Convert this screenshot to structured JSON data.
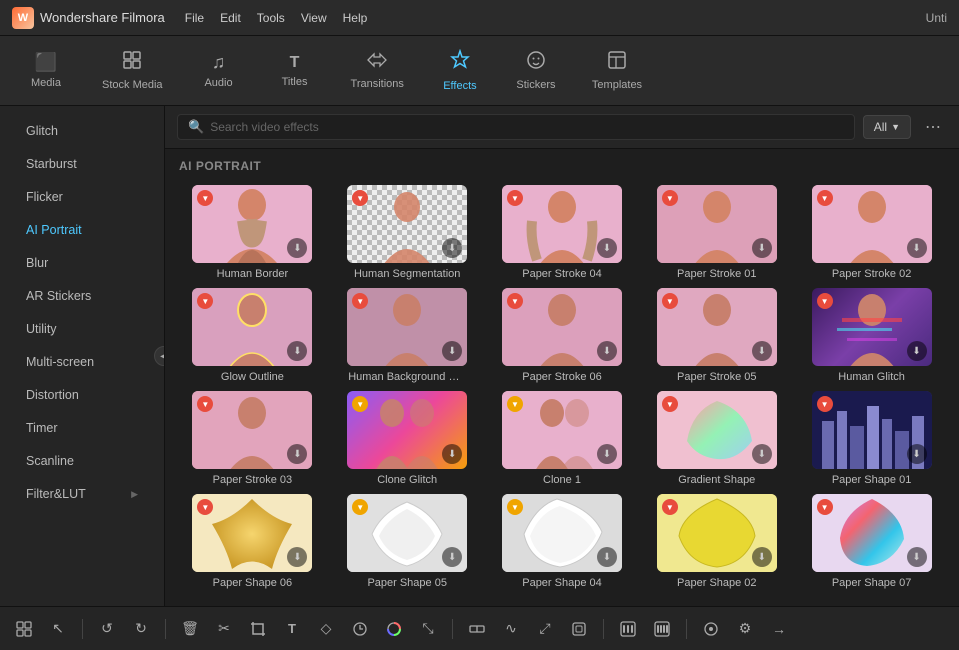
{
  "app": {
    "name": "Wondershare Filmora",
    "window_title": "Unti"
  },
  "menu": {
    "items": [
      "File",
      "Edit",
      "Tools",
      "View",
      "Help"
    ]
  },
  "top_nav": {
    "items": [
      {
        "id": "media",
        "label": "Media",
        "icon": "▦"
      },
      {
        "id": "stock",
        "label": "Stock Media",
        "icon": "⬜"
      },
      {
        "id": "audio",
        "label": "Audio",
        "icon": "♪"
      },
      {
        "id": "titles",
        "label": "Titles",
        "icon": "T"
      },
      {
        "id": "transitions",
        "label": "Transitions",
        "icon": "↺"
      },
      {
        "id": "effects",
        "label": "Effects",
        "icon": "✦"
      },
      {
        "id": "stickers",
        "label": "Stickers",
        "icon": "◎"
      },
      {
        "id": "templates",
        "label": "Templates",
        "icon": "⬜"
      }
    ],
    "active": "effects"
  },
  "sidebar": {
    "items": [
      {
        "id": "glitch",
        "label": "Glitch",
        "active": false
      },
      {
        "id": "starburst",
        "label": "Starburst",
        "active": false
      },
      {
        "id": "flicker",
        "label": "Flicker",
        "active": false
      },
      {
        "id": "ai-portrait",
        "label": "AI Portrait",
        "active": true
      },
      {
        "id": "blur",
        "label": "Blur",
        "active": false
      },
      {
        "id": "ar-stickers",
        "label": "AR Stickers",
        "active": false
      },
      {
        "id": "utility",
        "label": "Utility",
        "active": false
      },
      {
        "id": "multi-screen",
        "label": "Multi-screen",
        "active": false
      },
      {
        "id": "distortion",
        "label": "Distortion",
        "active": false
      },
      {
        "id": "timer",
        "label": "Timer",
        "active": false
      },
      {
        "id": "scanline",
        "label": "Scanline",
        "active": false
      },
      {
        "id": "filter-lut",
        "label": "Filter&LUT",
        "active": false,
        "has_arrow": true
      }
    ]
  },
  "search": {
    "placeholder": "Search video effects",
    "filter_label": "All",
    "more_icon": "⋯"
  },
  "section": {
    "title": "AI PORTRAIT"
  },
  "effects": {
    "rows": [
      [
        {
          "id": "human-border",
          "name": "Human Border",
          "badge": "red",
          "thumb": "pink-person"
        },
        {
          "id": "human-segmentation",
          "name": "Human Segmentation",
          "badge": "red",
          "thumb": "checkered-person"
        },
        {
          "id": "paper-stroke-04",
          "name": "Paper Stroke 04",
          "badge": "red",
          "thumb": "pink-person2"
        },
        {
          "id": "paper-stroke-01",
          "name": "Paper Stroke 01",
          "badge": "red",
          "thumb": "pink-person3"
        },
        {
          "id": "paper-stroke-02",
          "name": "Paper Stroke 02",
          "badge": "red",
          "thumb": "pink-person4"
        }
      ],
      [
        {
          "id": "glow-outline",
          "name": "Glow Outline",
          "badge": "red",
          "thumb": "pink-glow"
        },
        {
          "id": "human-bg-blur",
          "name": "Human Background Bl...",
          "badge": "red",
          "thumb": "pink-blur"
        },
        {
          "id": "paper-stroke-06",
          "name": "Paper Stroke 06",
          "badge": "red",
          "thumb": "pink-stroke6"
        },
        {
          "id": "paper-stroke-05",
          "name": "Paper Stroke 05",
          "badge": "red",
          "thumb": "pink-stroke5"
        },
        {
          "id": "human-glitch",
          "name": "Human Glitch",
          "badge": "red",
          "thumb": "glitch-person"
        }
      ],
      [
        {
          "id": "paper-stroke-03",
          "name": "Paper Stroke 03",
          "badge": "red",
          "thumb": "pink-stroke3"
        },
        {
          "id": "clone-glitch",
          "name": "Clone Glitch",
          "badge": "yellow",
          "thumb": "clone-glitch"
        },
        {
          "id": "clone-1",
          "name": "Clone 1",
          "badge": "yellow",
          "thumb": "clone1"
        },
        {
          "id": "gradient-shape",
          "name": "Gradient Shape",
          "badge": "red",
          "thumb": "gradient-shape"
        },
        {
          "id": "paper-shape-01",
          "name": "Paper Shape 01",
          "badge": "red",
          "thumb": "city-shape"
        }
      ],
      [
        {
          "id": "paper-shape-06",
          "name": "Paper Shape 06",
          "badge": "red",
          "thumb": "gold-shape"
        },
        {
          "id": "paper-shape-05",
          "name": "Paper Shape 05",
          "badge": "yellow",
          "thumb": "white-shape"
        },
        {
          "id": "paper-shape-04",
          "name": "Paper Shape 04",
          "badge": "yellow",
          "thumb": "white-shape2"
        },
        {
          "id": "paper-shape-02",
          "name": "Paper Shape 02",
          "badge": "red",
          "thumb": "yellow-shape"
        },
        {
          "id": "paper-shape-07",
          "name": "Paper Shape 07",
          "badge": "red",
          "thumb": "iridescent-shape"
        }
      ]
    ]
  },
  "bottom_toolbar": {
    "tools": [
      {
        "id": "multi-select",
        "icon": "⊞",
        "label": "Multi-select"
      },
      {
        "id": "pointer",
        "icon": "↖",
        "label": "Pointer"
      },
      {
        "id": "divider1",
        "type": "divider"
      },
      {
        "id": "undo",
        "icon": "↺",
        "label": "Undo"
      },
      {
        "id": "redo",
        "icon": "↻",
        "label": "Redo"
      },
      {
        "id": "divider2",
        "type": "divider"
      },
      {
        "id": "delete",
        "icon": "🗑",
        "label": "Delete"
      },
      {
        "id": "cut",
        "icon": "✂",
        "label": "Cut"
      },
      {
        "id": "crop",
        "icon": "⊡",
        "label": "Crop"
      },
      {
        "id": "text",
        "icon": "T",
        "label": "Text"
      },
      {
        "id": "keyframe",
        "icon": "◇",
        "label": "Keyframe"
      },
      {
        "id": "speed",
        "icon": "◉",
        "label": "Speed"
      },
      {
        "id": "color",
        "icon": "⬤",
        "label": "Color"
      },
      {
        "id": "transform",
        "icon": "⤡",
        "label": "Transform"
      },
      {
        "id": "divider3",
        "type": "divider"
      },
      {
        "id": "split",
        "icon": "⊏",
        "label": "Split"
      },
      {
        "id": "audio-split",
        "icon": "∿",
        "label": "Audio split"
      },
      {
        "id": "motion",
        "icon": "⤢",
        "label": "Motion"
      },
      {
        "id": "stabilize",
        "icon": "⊟",
        "label": "Stabilize"
      },
      {
        "id": "divider4",
        "type": "divider"
      },
      {
        "id": "zoom-in",
        "icon": "▣",
        "label": "Zoom in"
      },
      {
        "id": "zoom-out",
        "icon": "◱",
        "label": "Zoom out"
      },
      {
        "id": "divider5",
        "type": "divider"
      },
      {
        "id": "settings",
        "icon": "⚙",
        "label": "Settings"
      },
      {
        "id": "export",
        "icon": "→",
        "label": "Export"
      }
    ]
  }
}
